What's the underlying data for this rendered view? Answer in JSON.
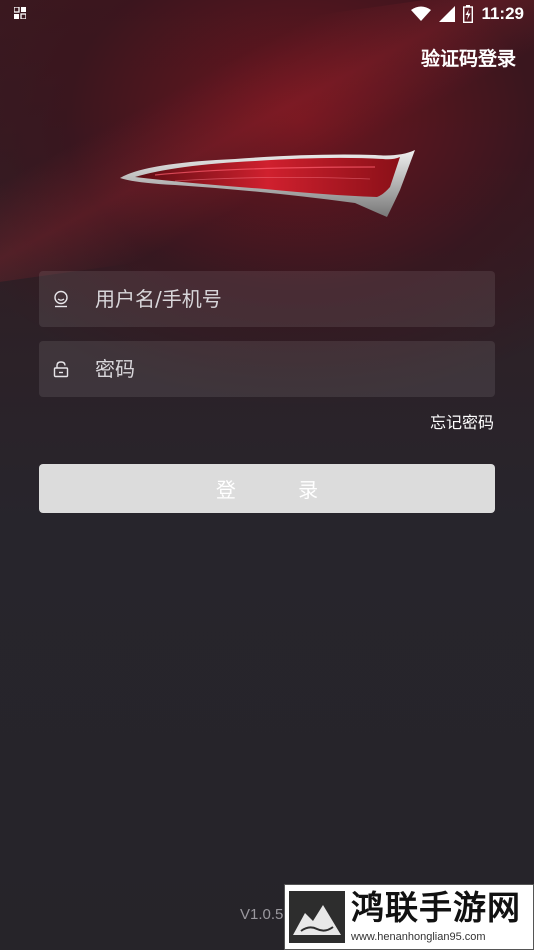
{
  "status_bar": {
    "time": "11:29",
    "icons": [
      "notification-icon",
      "wifi-icon",
      "signal-icon",
      "battery-icon"
    ]
  },
  "header": {
    "sms_login_label": "验证码登录"
  },
  "form": {
    "username_placeholder": "用户名/手机号",
    "username_value": "",
    "password_placeholder": "密码",
    "password_value": "",
    "forgot_label": "忘记密码",
    "login_label": "登 录"
  },
  "footer": {
    "version": "V1.0.5"
  },
  "watermark": {
    "title": "鸿联手游网",
    "url": "www.henanhonglian95.com"
  },
  "colors": {
    "accent_red": "#b01e2a",
    "button_bg": "#dcdcdc",
    "background": "#262429"
  }
}
